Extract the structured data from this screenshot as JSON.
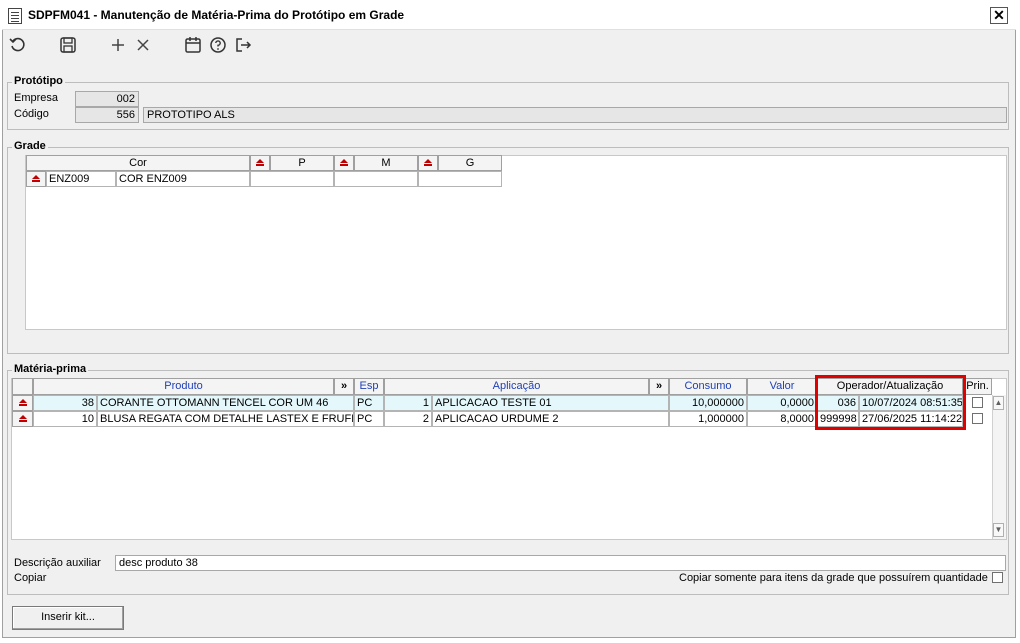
{
  "window": {
    "title": "SDPFM041 - Manutenção de Matéria-Prima do Protótipo em Grade",
    "close_glyph": "✕"
  },
  "toolbar": {
    "buttons": [
      {
        "name": "undo-icon"
      },
      {
        "name": "save-icon"
      },
      {
        "name": "add-icon"
      },
      {
        "name": "delete-icon"
      },
      {
        "name": "calendar-icon"
      },
      {
        "name": "help-icon"
      },
      {
        "name": "exit-icon"
      }
    ]
  },
  "prototipo": {
    "title": "Protótipo",
    "empresa_label": "Empresa",
    "empresa_value": "002",
    "codigo_label": "Código",
    "codigo_value": "556",
    "descricao_value": "PROTOTIPO ALS"
  },
  "grade": {
    "title": "Grade",
    "col_cor": "Cor",
    "sizes": [
      "P",
      "M",
      "G"
    ],
    "row": {
      "code": "ENZ009",
      "name": "COR ENZ009"
    }
  },
  "materia": {
    "title": "Matéria-prima",
    "headers": {
      "produto": "Produto",
      "expand": "»",
      "esp": "Esp",
      "aplicacao": "Aplicação",
      "consumo": "Consumo",
      "valor": "Valor",
      "operador": "Operador/Atualização",
      "prin": "Prin."
    },
    "rows": [
      {
        "cod": "38",
        "produto": "CORANTE OTTOMANN TENCEL COR UM 46",
        "esp": "PC",
        "apl_num": "1",
        "aplicacao": "APLICACAO TESTE 01",
        "consumo": "10,000000",
        "valor": "0,0000",
        "operador": "036",
        "data": "10/07/2024 08:51:35",
        "prin": false
      },
      {
        "cod": "10",
        "produto": "BLUSA REGATA COM DETALHE LASTEX E FRUFRU R",
        "esp": "PC",
        "apl_num": "2",
        "aplicacao": "APLICACAO URDUME 2",
        "consumo": "1,000000",
        "valor": "8,0000",
        "operador": "999998",
        "data": "27/06/2025 11:14:22",
        "prin": false
      }
    ]
  },
  "footer": {
    "descricao_label": "Descrição auxiliar",
    "descricao_value": "desc produto 38",
    "copiar_label": "Copiar",
    "copiar_somente_label": "Copiar somente para itens da grade que possuírem quantidade",
    "inserir_kit_label": "Inserir kit..."
  },
  "colors": {
    "highlight": "#e00000",
    "header_text_blue": "#1f3fb5",
    "selected_row": "#e4f7fb",
    "eject_red": "#c00000"
  }
}
